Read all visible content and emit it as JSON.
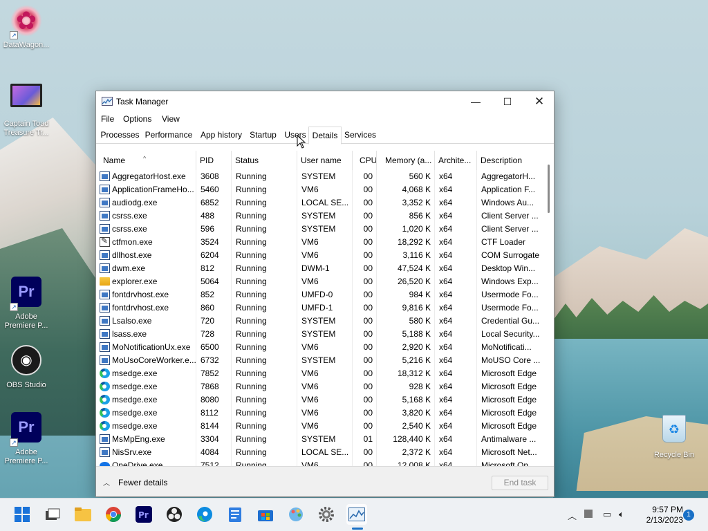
{
  "desktop": {
    "icons": [
      {
        "label": "DataWagon..."
      },
      {
        "label": "Captain Toad Treasure Tr..."
      },
      {
        "label": "Adobe Premiere P..."
      },
      {
        "label": "OBS Studio"
      },
      {
        "label": "Adobe Premiere P..."
      },
      {
        "label": "Recycle Bin"
      }
    ],
    "premiere_glyph": "Pr"
  },
  "window": {
    "title": "Task Manager",
    "controls": {
      "minimize": "—",
      "maximize": "☐",
      "close": "✕"
    },
    "menu": [
      "File",
      "Options",
      "View"
    ],
    "tabs": [
      "Processes",
      "Performance",
      "App history",
      "Startup",
      "Users",
      "Details",
      "Services"
    ],
    "active_tab": "Details",
    "columns": [
      "Name",
      "PID",
      "Status",
      "User name",
      "CPU",
      "Memory (a...",
      "Archite...",
      "Description"
    ],
    "sort_indicator": "^",
    "rows": [
      {
        "name": "AggregatorHost.exe",
        "pid": "3608",
        "status": "Running",
        "user": "SYSTEM",
        "cpu": "00",
        "mem": "560 K",
        "arch": "x64",
        "desc": "AggregatorH...",
        "icon": "app"
      },
      {
        "name": "ApplicationFrameHo...",
        "pid": "5460",
        "status": "Running",
        "user": "VM6",
        "cpu": "00",
        "mem": "4,068 K",
        "arch": "x64",
        "desc": "Application F...",
        "icon": "app"
      },
      {
        "name": "audiodg.exe",
        "pid": "6852",
        "status": "Running",
        "user": "LOCAL SE...",
        "cpu": "00",
        "mem": "3,352 K",
        "arch": "x64",
        "desc": "Windows Au...",
        "icon": "app"
      },
      {
        "name": "csrss.exe",
        "pid": "488",
        "status": "Running",
        "user": "SYSTEM",
        "cpu": "00",
        "mem": "856 K",
        "arch": "x64",
        "desc": "Client Server ...",
        "icon": "app"
      },
      {
        "name": "csrss.exe",
        "pid": "596",
        "status": "Running",
        "user": "SYSTEM",
        "cpu": "00",
        "mem": "1,020 K",
        "arch": "x64",
        "desc": "Client Server ...",
        "icon": "app"
      },
      {
        "name": "ctfmon.exe",
        "pid": "3524",
        "status": "Running",
        "user": "VM6",
        "cpu": "00",
        "mem": "18,292 K",
        "arch": "x64",
        "desc": "CTF Loader",
        "icon": "ctf"
      },
      {
        "name": "dllhost.exe",
        "pid": "6204",
        "status": "Running",
        "user": "VM6",
        "cpu": "00",
        "mem": "3,116 K",
        "arch": "x64",
        "desc": "COM Surrogate",
        "icon": "app"
      },
      {
        "name": "dwm.exe",
        "pid": "812",
        "status": "Running",
        "user": "DWM-1",
        "cpu": "00",
        "mem": "47,524 K",
        "arch": "x64",
        "desc": "Desktop Win...",
        "icon": "app"
      },
      {
        "name": "explorer.exe",
        "pid": "5064",
        "status": "Running",
        "user": "VM6",
        "cpu": "00",
        "mem": "26,520 K",
        "arch": "x64",
        "desc": "Windows Exp...",
        "icon": "folder"
      },
      {
        "name": "fontdrvhost.exe",
        "pid": "852",
        "status": "Running",
        "user": "UMFD-0",
        "cpu": "00",
        "mem": "984 K",
        "arch": "x64",
        "desc": "Usermode Fo...",
        "icon": "app"
      },
      {
        "name": "fontdrvhost.exe",
        "pid": "860",
        "status": "Running",
        "user": "UMFD-1",
        "cpu": "00",
        "mem": "9,816 K",
        "arch": "x64",
        "desc": "Usermode Fo...",
        "icon": "app"
      },
      {
        "name": "Lsalso.exe",
        "pid": "720",
        "status": "Running",
        "user": "SYSTEM",
        "cpu": "00",
        "mem": "580 K",
        "arch": "x64",
        "desc": "Credential Gu...",
        "icon": "app"
      },
      {
        "name": "lsass.exe",
        "pid": "728",
        "status": "Running",
        "user": "SYSTEM",
        "cpu": "00",
        "mem": "5,188 K",
        "arch": "x64",
        "desc": "Local Security...",
        "icon": "app"
      },
      {
        "name": "MoNotificationUx.exe",
        "pid": "6500",
        "status": "Running",
        "user": "VM6",
        "cpu": "00",
        "mem": "2,920 K",
        "arch": "x64",
        "desc": "MoNotificati...",
        "icon": "app"
      },
      {
        "name": "MoUsoCoreWorker.e...",
        "pid": "6732",
        "status": "Running",
        "user": "SYSTEM",
        "cpu": "00",
        "mem": "5,216 K",
        "arch": "x64",
        "desc": "MoUSO Core ...",
        "icon": "app"
      },
      {
        "name": "msedge.exe",
        "pid": "7852",
        "status": "Running",
        "user": "VM6",
        "cpu": "00",
        "mem": "18,312 K",
        "arch": "x64",
        "desc": "Microsoft Edge",
        "icon": "edge"
      },
      {
        "name": "msedge.exe",
        "pid": "7868",
        "status": "Running",
        "user": "VM6",
        "cpu": "00",
        "mem": "928 K",
        "arch": "x64",
        "desc": "Microsoft Edge",
        "icon": "edge"
      },
      {
        "name": "msedge.exe",
        "pid": "8080",
        "status": "Running",
        "user": "VM6",
        "cpu": "00",
        "mem": "5,168 K",
        "arch": "x64",
        "desc": "Microsoft Edge",
        "icon": "edge"
      },
      {
        "name": "msedge.exe",
        "pid": "8112",
        "status": "Running",
        "user": "VM6",
        "cpu": "00",
        "mem": "3,820 K",
        "arch": "x64",
        "desc": "Microsoft Edge",
        "icon": "edge"
      },
      {
        "name": "msedge.exe",
        "pid": "8144",
        "status": "Running",
        "user": "VM6",
        "cpu": "00",
        "mem": "2,540 K",
        "arch": "x64",
        "desc": "Microsoft Edge",
        "icon": "edge"
      },
      {
        "name": "MsMpEng.exe",
        "pid": "3304",
        "status": "Running",
        "user": "SYSTEM",
        "cpu": "01",
        "mem": "128,440 K",
        "arch": "x64",
        "desc": "Antimalware ...",
        "icon": "app"
      },
      {
        "name": "NisSrv.exe",
        "pid": "4084",
        "status": "Running",
        "user": "LOCAL SE...",
        "cpu": "00",
        "mem": "2,372 K",
        "arch": "x64",
        "desc": "Microsoft Net...",
        "icon": "app"
      },
      {
        "name": "OneDrive.exe",
        "pid": "7512",
        "status": "Running",
        "user": "VM6",
        "cpu": "00",
        "mem": "12,008 K",
        "arch": "x64",
        "desc": "Microsoft On...",
        "icon": "cloud"
      }
    ],
    "footer": {
      "fewer_details": "Fewer details",
      "end_task": "End task"
    }
  },
  "taskbar": {
    "icons": [
      "start-icon",
      "task-view-icon",
      "file-explorer-icon",
      "chrome-icon",
      "premiere-icon",
      "obs-icon",
      "edge-icon",
      "notepad-icon",
      "store-icon",
      "paint-icon",
      "settings-icon",
      "task-manager-icon"
    ],
    "time": "9:57 PM",
    "date": "2/13/2023",
    "notification_count": "1",
    "colors": {
      "accent": "#1970c6"
    }
  }
}
